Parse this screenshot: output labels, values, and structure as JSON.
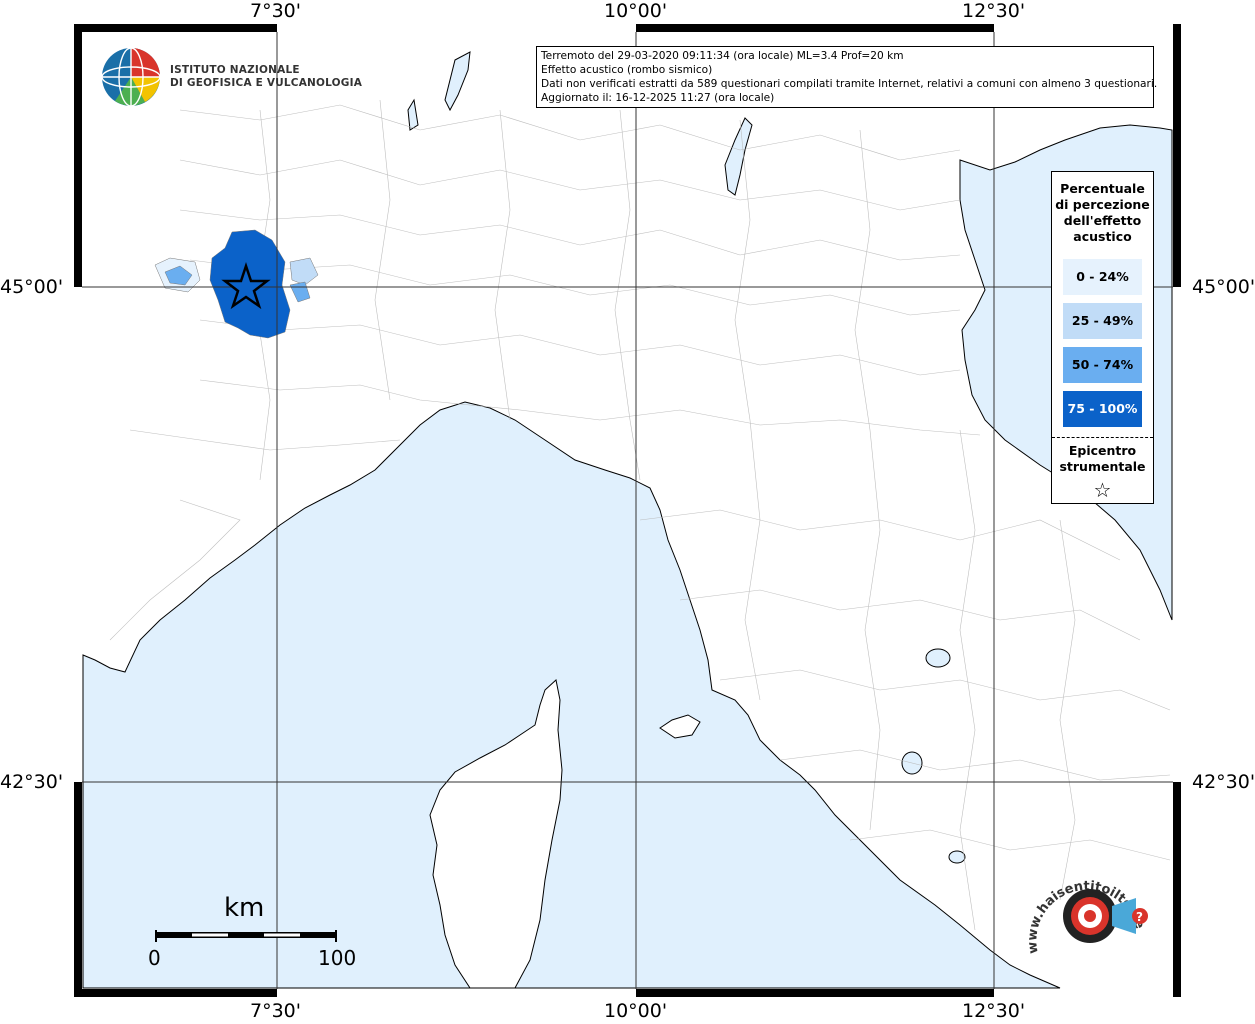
{
  "axes": {
    "lon_top": [
      "7°30'",
      "10°00'",
      "12°30'"
    ],
    "lon_bottom": [
      "7°30'",
      "10°00'",
      "12°30'"
    ],
    "lat_left": [
      "45°00'",
      "42°30'"
    ],
    "lat_right": [
      "45°00'",
      "42°30'"
    ]
  },
  "info": {
    "line1": "Terremoto del 29-03-2020 09:11:34 (ora locale) ML=3.4 Prof=20 km",
    "line2": "Effetto acustico (rombo sismico)",
    "line3": "Dati non verificati estratti da 589 questionari compilati tramite Internet, relativi a comuni con almeno 3 questionari.",
    "line4": "Aggiornato il: 16-12-2025 11:27 (ora locale)"
  },
  "legend": {
    "title_lines": [
      "Percentuale",
      "di percezione",
      "dell'effetto",
      "acustico"
    ],
    "classes": [
      {
        "label": "0 - 24%",
        "color": "#e6f2fd"
      },
      {
        "label": "25 - 49%",
        "color": "#c1dcf7"
      },
      {
        "label": "50 - 74%",
        "color": "#6aaef0"
      },
      {
        "label": "75 - 100%",
        "color": "#0b62c9"
      }
    ],
    "epicenter_lines": [
      "Epicentro",
      "strumentale"
    ]
  },
  "logo_ingv": {
    "line1": "ISTITUTO NAZIONALE",
    "line2": "DI GEOFISICA E VULCANOLOGIA"
  },
  "scale": {
    "unit": "km",
    "min": "0",
    "max": "100"
  },
  "logo_hst": {
    "text": "www.haisentitoilterremoto.it"
  },
  "colors": {
    "sea": "#e0f0fd",
    "land": "#ffffff",
    "border": "#999999"
  },
  "epicenter": {
    "lon": 7.23,
    "lat": 45.0
  }
}
